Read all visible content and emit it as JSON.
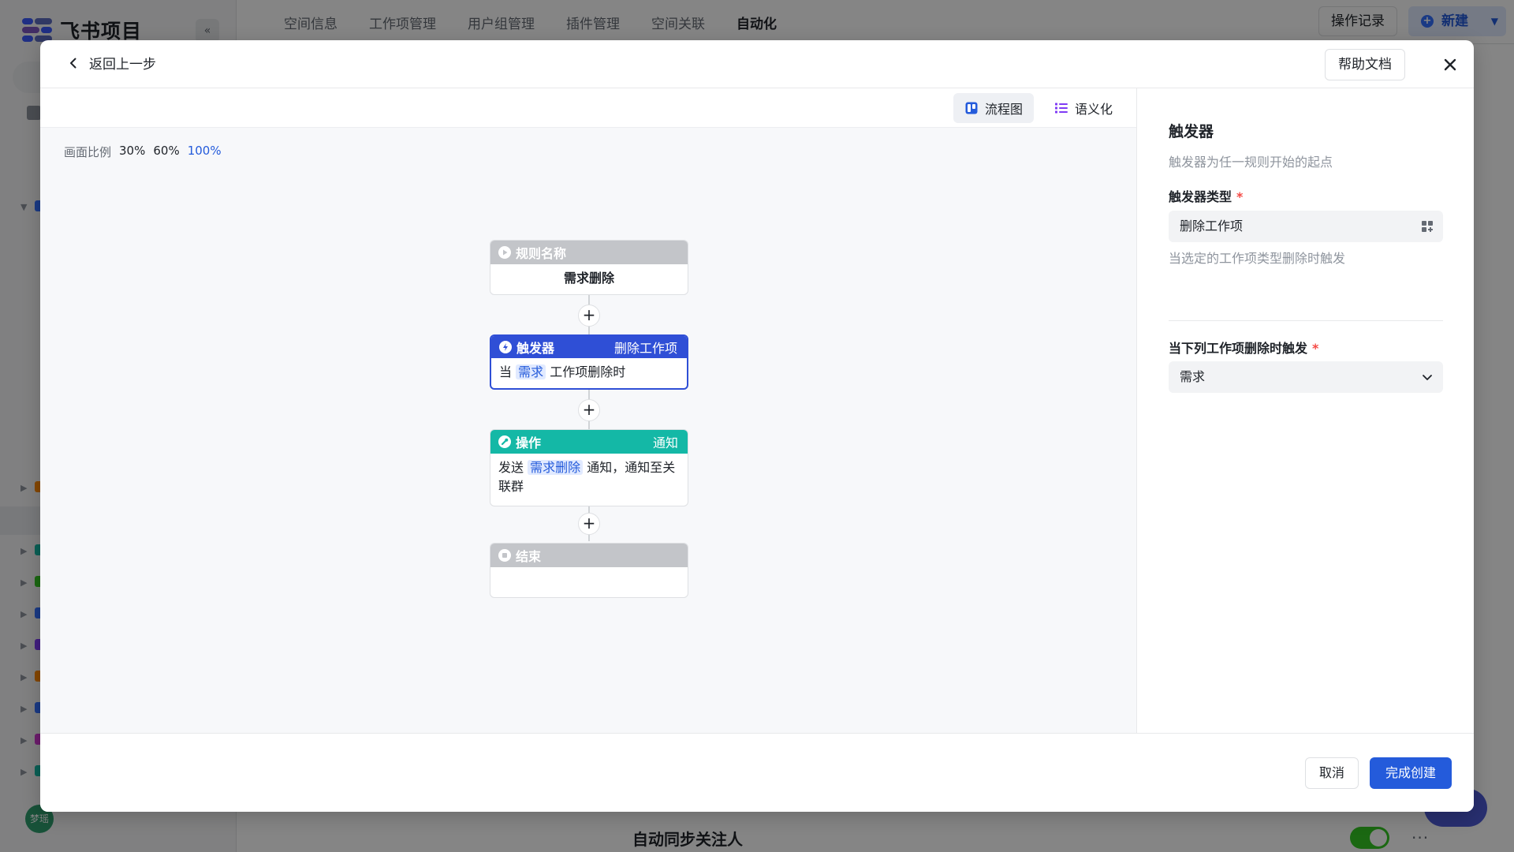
{
  "app": {
    "name": "飞书项目",
    "tabs": [
      "空间信息",
      "工作项管理",
      "用户组管理",
      "插件管理",
      "空间关联",
      "自动化"
    ],
    "active_tab": "自动化",
    "log_label": "操作记录",
    "new_label": "新建",
    "avatar_label": "梦瑶",
    "bottom_title": "自动同步关注人",
    "more_label": "···"
  },
  "modal": {
    "back_label": "返回上一步",
    "help_label": "帮助文档"
  },
  "canvas": {
    "views": [
      "流程图",
      "语义化"
    ],
    "active_view": "流程图",
    "zoom_label": "画面比例",
    "zoom_options": [
      "30%",
      "60%",
      "100%"
    ],
    "zoom_active": "100%",
    "nodes": {
      "rule": {
        "title": "规则名称",
        "body": "需求删除"
      },
      "trigger": {
        "title": "触发器",
        "tag": "删除工作项",
        "prefix": "当",
        "chip": "需求",
        "suffix": "工作项删除时"
      },
      "action": {
        "title": "操作",
        "tag": "通知",
        "prefix": "发送",
        "chip": "需求删除",
        "suffix": "通知，通知至关联群"
      },
      "end": {
        "title": "结束"
      }
    },
    "plus_label": "+"
  },
  "side": {
    "title": "触发器",
    "desc": "触发器为任一规则开始的起点",
    "type_label": "触发器类型",
    "type_value": "删除工作项",
    "type_hint": "当选定的工作项类型删除时触发",
    "when_label": "当下列工作项删除时触发",
    "when_value": "需求",
    "required_mark": "*"
  },
  "footer": {
    "cancel_label": "取消",
    "create_label": "完成创建"
  },
  "colors": {
    "trigger_header": "#2f4fd6",
    "action_header": "#14b8a6",
    "neutral_header": "#c3c5c9",
    "primary": "#245bdb"
  }
}
